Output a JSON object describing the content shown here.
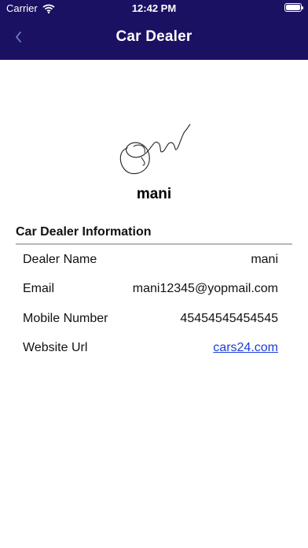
{
  "status_bar": {
    "carrier": "Carrier",
    "time": "12:42 PM"
  },
  "header": {
    "title": "Car Dealer",
    "background_color": "#1b1163"
  },
  "profile": {
    "name": "mani"
  },
  "info": {
    "section_title": "Car Dealer Information",
    "rows": [
      {
        "label": "Dealer Name",
        "value": "mani"
      },
      {
        "label": "Email",
        "value": "mani12345@yopmail.com"
      },
      {
        "label": "Mobile Number",
        "value": "45454545454545"
      },
      {
        "label": "Website Url",
        "value": "cars24.com"
      }
    ]
  },
  "colors": {
    "link": "#1a3fd6"
  }
}
